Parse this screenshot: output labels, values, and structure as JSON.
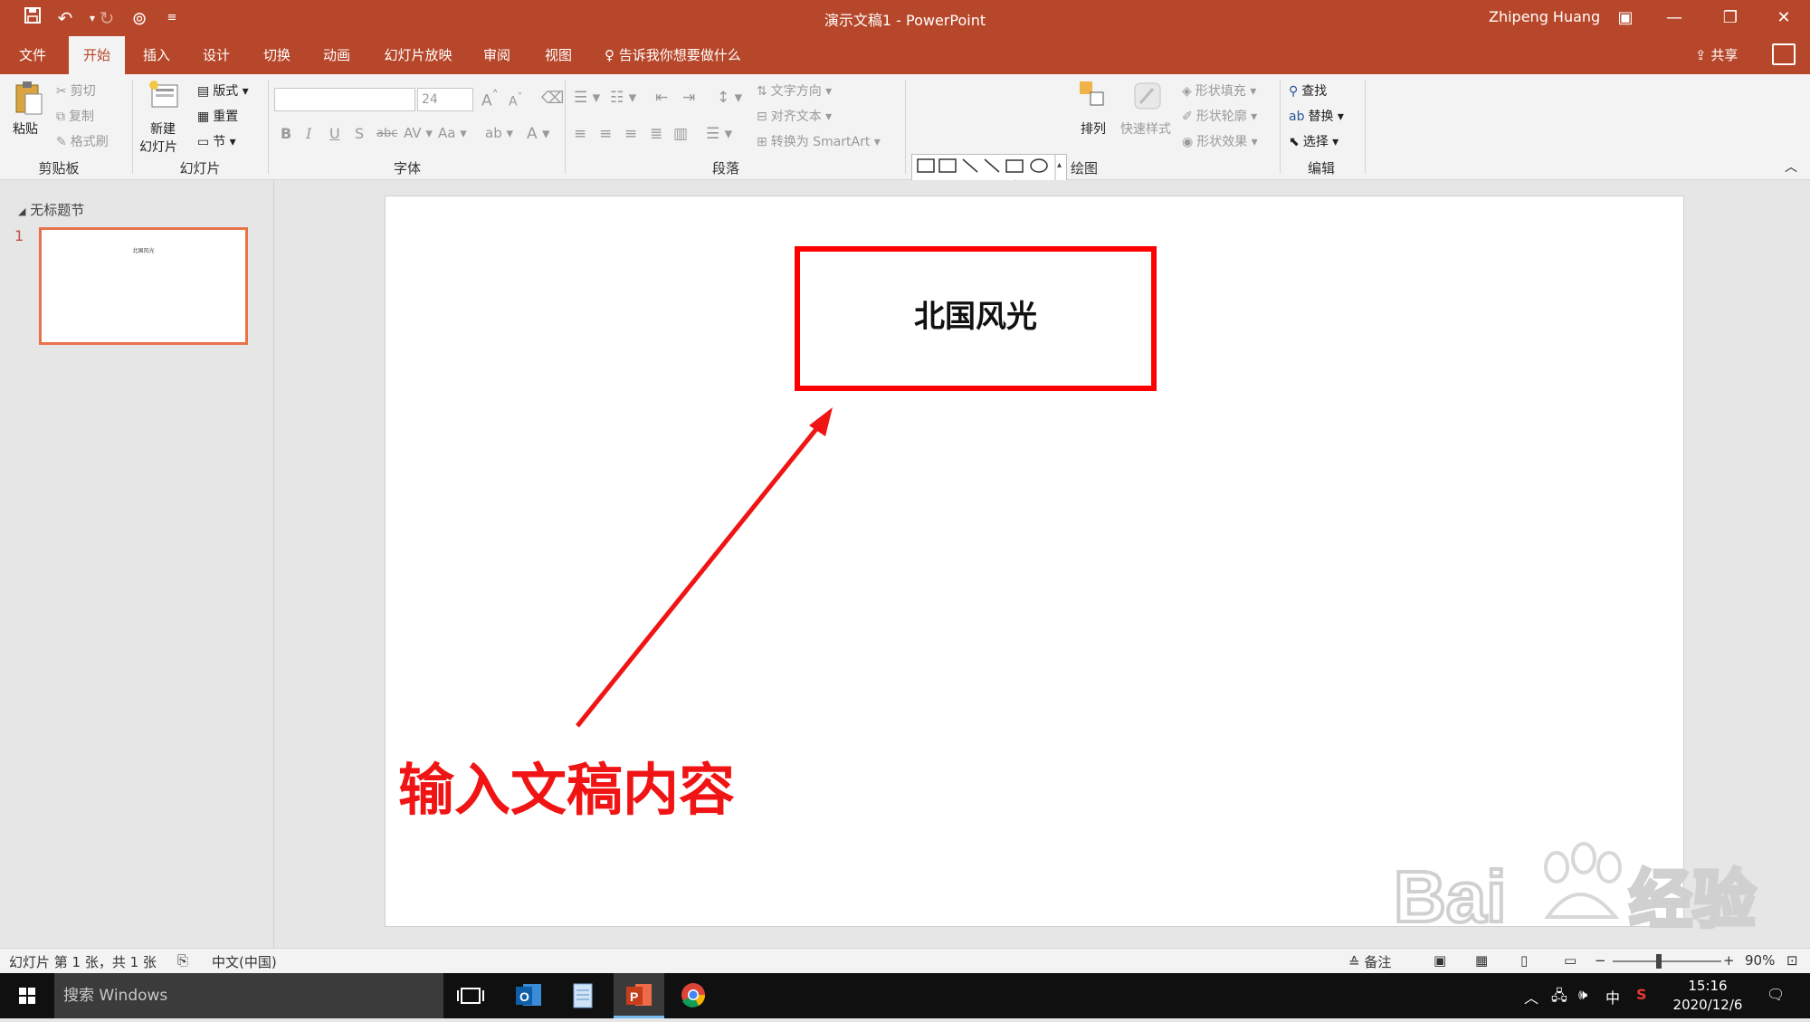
{
  "window": {
    "title": "演示文稿1  -  PowerPoint",
    "user": "Zhipeng Huang"
  },
  "tabs": [
    "文件",
    "开始",
    "插入",
    "设计",
    "切换",
    "动画",
    "幻灯片放映",
    "审阅",
    "视图"
  ],
  "tell_me": "告诉我你想要做什么",
  "share": "共享",
  "ribbon": {
    "clipboard": {
      "label": "剪贴板",
      "paste": "粘贴",
      "cut": "剪切",
      "copy": "复制",
      "format_painter": "格式刷"
    },
    "slides": {
      "label": "幻灯片",
      "new_slide_1": "新建",
      "new_slide_2": "幻灯片",
      "layout": "版式",
      "reset": "重置",
      "section": "节"
    },
    "font": {
      "label": "字体",
      "font_name": "",
      "font_size": "24"
    },
    "paragraph": {
      "label": "段落",
      "text_direction": "文字方向",
      "align_text": "对齐文本",
      "smartart": "转换为 SmartArt"
    },
    "drawing": {
      "label": "绘图",
      "arrange": "排列",
      "quick_styles": "快速样式",
      "shape_fill": "形状填充",
      "shape_outline": "形状轮廓",
      "shape_effects": "形状效果"
    },
    "editing": {
      "label": "编辑",
      "find": "查找",
      "replace": "替换",
      "select": "选择"
    }
  },
  "slide_panel": {
    "section": "无标题节",
    "slide_number": "1",
    "thumb_text": "北国风光"
  },
  "slide": {
    "title": "北国风光",
    "annotation": "输入文稿内容"
  },
  "status": {
    "slide_info": "幻灯片 第 1 张，共 1 张",
    "language": "中文(中国)",
    "notes": "备注",
    "zoom": "90%"
  },
  "taskbar": {
    "search_placeholder": "搜索 Windows",
    "time": "15:16",
    "date": "2020/12/6",
    "ime": "中"
  },
  "colors": {
    "accent": "#b7472a",
    "annotation_red": "#ff0000",
    "thumb_border": "#e8734a"
  }
}
